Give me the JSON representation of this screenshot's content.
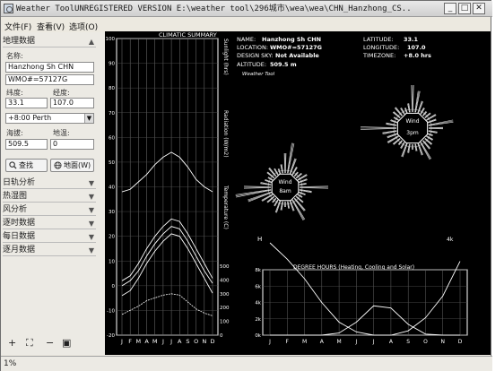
{
  "window": {
    "title": "Weather ToolUNREGISTERED VERSION  E:\\weather  tool\\296城市\\wea\\wea\\CHN_Hanzhong_CS...",
    "minimize": "_",
    "maximize": "□",
    "close": "✕"
  },
  "menu": {
    "file": "文件(F)",
    "view": "查看(V)",
    "options": "选项(O)"
  },
  "sidebar": {
    "geo_section": "地理数据",
    "name_label": "名称:",
    "name_value": "Hanzhong Sh CHN",
    "wmo_value": "WMO#=57127G",
    "lat_label": "纬度:",
    "lon_label": "经度:",
    "lat_value": "33.1",
    "lon_value": "107.0",
    "tz_value": "+8:00 Perth",
    "alt_label": "海拔:",
    "ground_label": "地温:",
    "alt_value": "509.5",
    "ground_value": "0",
    "search_btn": "查找",
    "sw_btn": "地面(W)",
    "sections": [
      "日轨分析",
      "热湿图",
      "风分析",
      "逐时数据",
      "每日数据",
      "逐月数据"
    ]
  },
  "toolbar": {
    "add": "+",
    "fit": "⛶",
    "minus": "−",
    "export": "▣"
  },
  "status": {
    "text": "1%"
  },
  "climatic": {
    "title": "CLIMATIC SUMMARY",
    "months": [
      "J",
      "F",
      "M",
      "A",
      "M",
      "J",
      "J",
      "A",
      "S",
      "O",
      "N",
      "D"
    ],
    "left_ticks": [
      "100",
      "90",
      "80",
      "70",
      "60",
      "50",
      "40",
      "30",
      "20",
      "10",
      "0",
      "-10",
      "-20"
    ],
    "right_ticks": [
      "500",
      "400",
      "300",
      "200",
      "100",
      "0"
    ],
    "right_labels": [
      "Sunlight (hrs)",
      "Radiation (W/m2)",
      "Temperature (C)"
    ]
  },
  "info": {
    "name_key": "NAME:",
    "name_val": "Hanzhong Sh CHN",
    "loc_key": "LOCATION:",
    "loc_val": "WMO#=57127G",
    "sky_key": "DESIGN SKY:",
    "sky_val": "Not Available",
    "alt_key": "ALTITUDE:",
    "alt_val": "509.5 m",
    "source": "Weather Tool",
    "lat_key": "LATITUDE:",
    "lat_val": "33.1",
    "lon_key": "LONGITUDE:",
    "lon_val": "107.0",
    "tz_key": "TIMEZONE:",
    "tz_val": "+8.0 hrs"
  },
  "wind": {
    "label1": "Wind",
    "label1b": "8am",
    "label2": "Wind",
    "label2b": "3pm"
  },
  "degree": {
    "title": "DEGREE HOURS (Heating, Cooling and Solar)",
    "y_top": "4k",
    "y_ticks": [
      "8k",
      "6k",
      "4k",
      "2k",
      "0k"
    ],
    "months": [
      "J",
      "F",
      "M",
      "A",
      "M",
      "J",
      "J",
      "A",
      "S",
      "O",
      "N",
      "D"
    ],
    "left_letter": "H"
  },
  "chart_data": [
    {
      "type": "line",
      "title": "CLIMATIC SUMMARY",
      "categories": [
        "J",
        "F",
        "M",
        "A",
        "M",
        "J",
        "J",
        "A",
        "S",
        "O",
        "N",
        "D"
      ],
      "ylim": [
        -20,
        100
      ],
      "y2lim": [
        0,
        500
      ],
      "series": [
        {
          "values": [
            38,
            39,
            42,
            45,
            49,
            52,
            54,
            52,
            48,
            43,
            40,
            38
          ]
        },
        {
          "values": [
            2,
            4,
            9,
            15,
            20,
            24,
            27,
            26,
            21,
            15,
            9,
            3
          ]
        },
        {
          "values": [
            0,
            2,
            6,
            12,
            17,
            21,
            24,
            23,
            18,
            12,
            6,
            1
          ]
        },
        {
          "values": [
            -4,
            -2,
            3,
            9,
            14,
            18,
            21,
            20,
            15,
            9,
            3,
            -3
          ]
        }
      ],
      "radiation": [
        150,
        180,
        210,
        250,
        270,
        290,
        300,
        290,
        240,
        190,
        160,
        140
      ]
    },
    {
      "type": "line",
      "title": "DEGREE HOURS (Heating, Cooling and Solar)",
      "categories": [
        "J",
        "F",
        "M",
        "A",
        "M",
        "J",
        "J",
        "A",
        "S",
        "O",
        "N",
        "D"
      ],
      "series": [
        {
          "values": [
            8.5,
            7.0,
            5.2,
            3.0,
            1.2,
            0.3,
            0,
            0,
            0.4,
            1.6,
            3.6,
            6.8
          ]
        },
        {
          "values": [
            0,
            0,
            0,
            0,
            0.2,
            1.2,
            2.7,
            2.5,
            1.0,
            0.1,
            0,
            0
          ]
        }
      ]
    }
  ]
}
